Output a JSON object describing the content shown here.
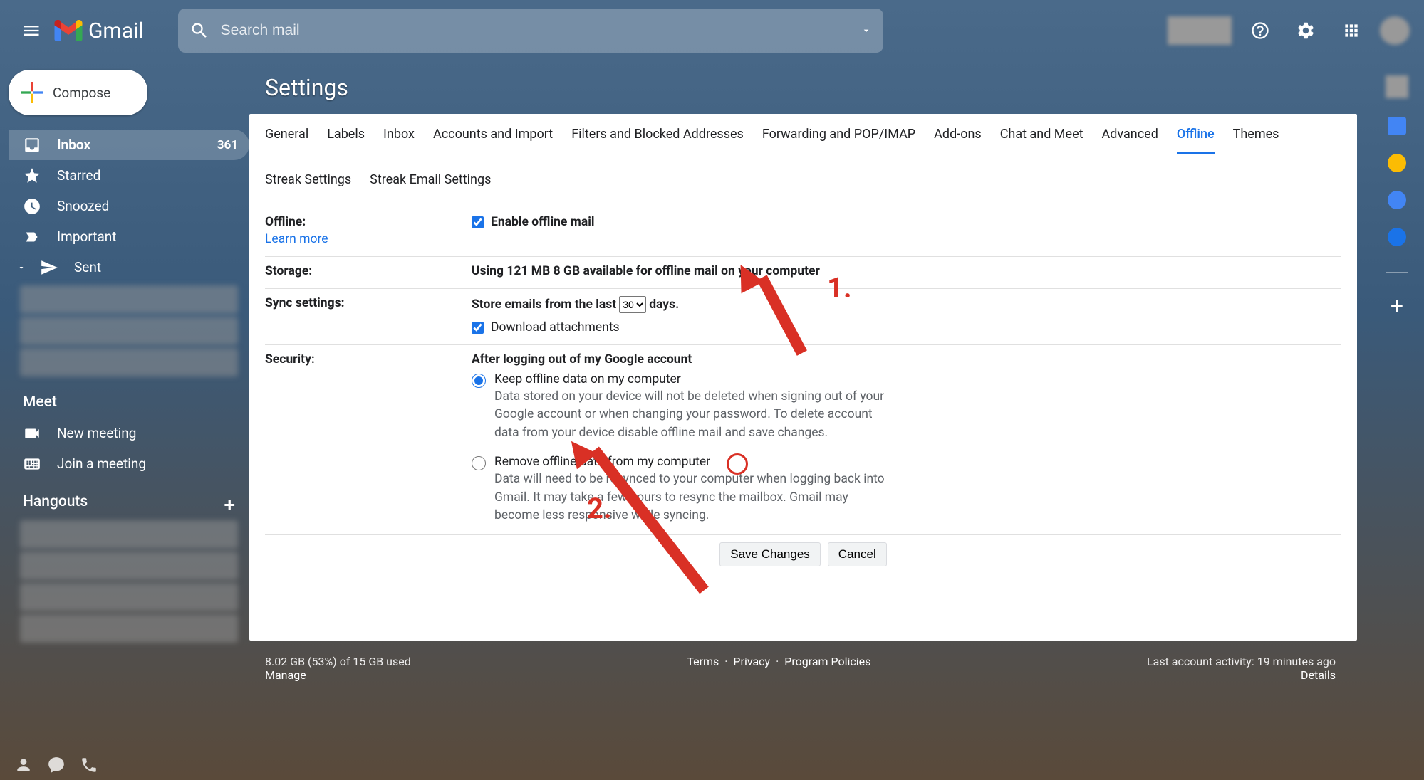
{
  "header": {
    "app_name": "Gmail",
    "search_placeholder": "Search mail"
  },
  "compose_label": "Compose",
  "nav": [
    {
      "icon": "inbox",
      "label": "Inbox",
      "count": "361",
      "active": true
    },
    {
      "icon": "star",
      "label": "Starred"
    },
    {
      "icon": "clock",
      "label": "Snoozed"
    },
    {
      "icon": "important",
      "label": "Important"
    },
    {
      "icon": "send",
      "label": "Sent"
    }
  ],
  "meet": {
    "title": "Meet",
    "new_meeting": "New meeting",
    "join_meeting": "Join a meeting"
  },
  "hangouts_title": "Hangouts",
  "page_title": "Settings",
  "tabs": [
    "General",
    "Labels",
    "Inbox",
    "Accounts and Import",
    "Filters and Blocked Addresses",
    "Forwarding and POP/IMAP",
    "Add-ons",
    "Chat and Meet",
    "Advanced",
    "Offline",
    "Themes",
    "Streak Settings",
    "Streak Email Settings"
  ],
  "active_tab": "Offline",
  "offline": {
    "label": "Offline:",
    "learn_more": "Learn more",
    "enable_label": "Enable offline mail"
  },
  "storage": {
    "label": "Storage:",
    "text_before": "Using 121 MB ",
    "text_after": "8 GB available for offline mail on your computer"
  },
  "sync": {
    "label": "Sync settings:",
    "text_before": "Store emails from the last ",
    "select_value": "30",
    "text_after": " days.",
    "download_label": "Download attachments"
  },
  "security": {
    "label": "Security:",
    "heading": "After logging out of my Google account",
    "opt1_title": "Keep offline data on my computer",
    "opt1_desc": "Data stored on your device will not be deleted when signing out of your Google account or when changing your password. To delete account data from your device disable offline mail and save changes.",
    "opt2_title": "Remove offline data from my computer",
    "opt2_desc": "Data will need to be resynced to your computer when logging back into Gmail. It may take a few hours to resync the mailbox. Gmail may become less responsive while syncing."
  },
  "buttons": {
    "save": "Save Changes",
    "cancel": "Cancel"
  },
  "footer": {
    "storage": "8.02 GB (53%) of 15 GB used",
    "manage": "Manage",
    "terms": "Terms",
    "privacy": "Privacy",
    "policies": "Program Policies",
    "activity": "Last account activity: 19 minutes ago",
    "details": "Details"
  },
  "annot": {
    "one": "1.",
    "two": "2."
  }
}
